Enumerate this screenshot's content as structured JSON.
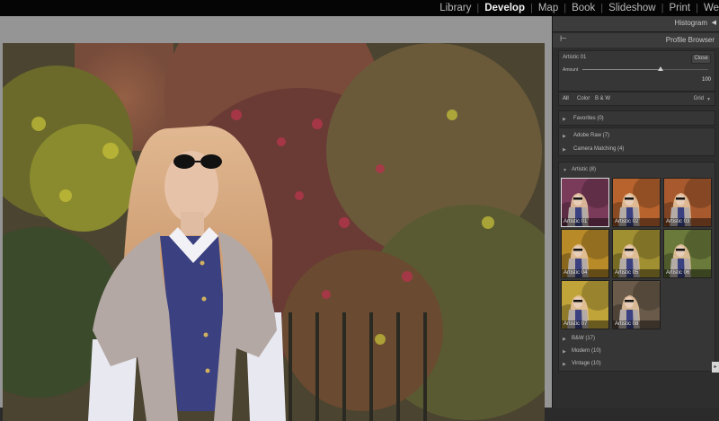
{
  "module_picker": {
    "items": [
      {
        "label": "Library",
        "active": false
      },
      {
        "label": "Develop",
        "active": true
      },
      {
        "label": "Map",
        "active": false
      },
      {
        "label": "Book",
        "active": false
      },
      {
        "label": "Slideshow",
        "active": false
      },
      {
        "label": "Print",
        "active": false
      },
      {
        "label": "We",
        "active": false
      }
    ],
    "separator": "|"
  },
  "histogram": {
    "label": "Histogram",
    "collapse_glyph": "◀"
  },
  "profile_browser": {
    "label": "Profile Browser",
    "back_glyph": "⊢",
    "profile_name": "Artistic 01",
    "close_label": "Close",
    "amount_label": "Amount",
    "amount_value": "100",
    "amount_fraction": 0.62,
    "filters": [
      "All",
      "Color",
      "B & W"
    ],
    "view_label": "Grid",
    "groups_top": [
      {
        "label": "Favorites (0)"
      },
      {
        "label": "Adobe Raw (7)"
      },
      {
        "label": "Camera Matching (4)"
      }
    ],
    "open_group": {
      "label": "Artistic (8)"
    },
    "thumbnails": [
      {
        "label": "Artistic 01",
        "selected": true,
        "tint": "#7a3a5a"
      },
      {
        "label": "Artistic 02",
        "selected": false,
        "tint": "#b8632e"
      },
      {
        "label": "Artistic 03",
        "selected": false,
        "tint": "#a85a2e"
      },
      {
        "label": "Artistic 04",
        "selected": false,
        "tint": "#b88a28"
      },
      {
        "label": "Artistic 05",
        "selected": false,
        "tint": "#a09032"
      },
      {
        "label": "Artistic 06",
        "selected": false,
        "tint": "#6a7a3a"
      },
      {
        "label": "Artistic 07",
        "selected": false,
        "tint": "#c0a43a"
      },
      {
        "label": "Artistic 08",
        "selected": false,
        "tint": "#6a5a4a"
      }
    ],
    "groups_bottom": [
      {
        "label": "B&W (17)"
      },
      {
        "label": "Modern (10)"
      },
      {
        "label": "Vintage (10)"
      }
    ]
  },
  "panel_tab_glyph": "▸"
}
